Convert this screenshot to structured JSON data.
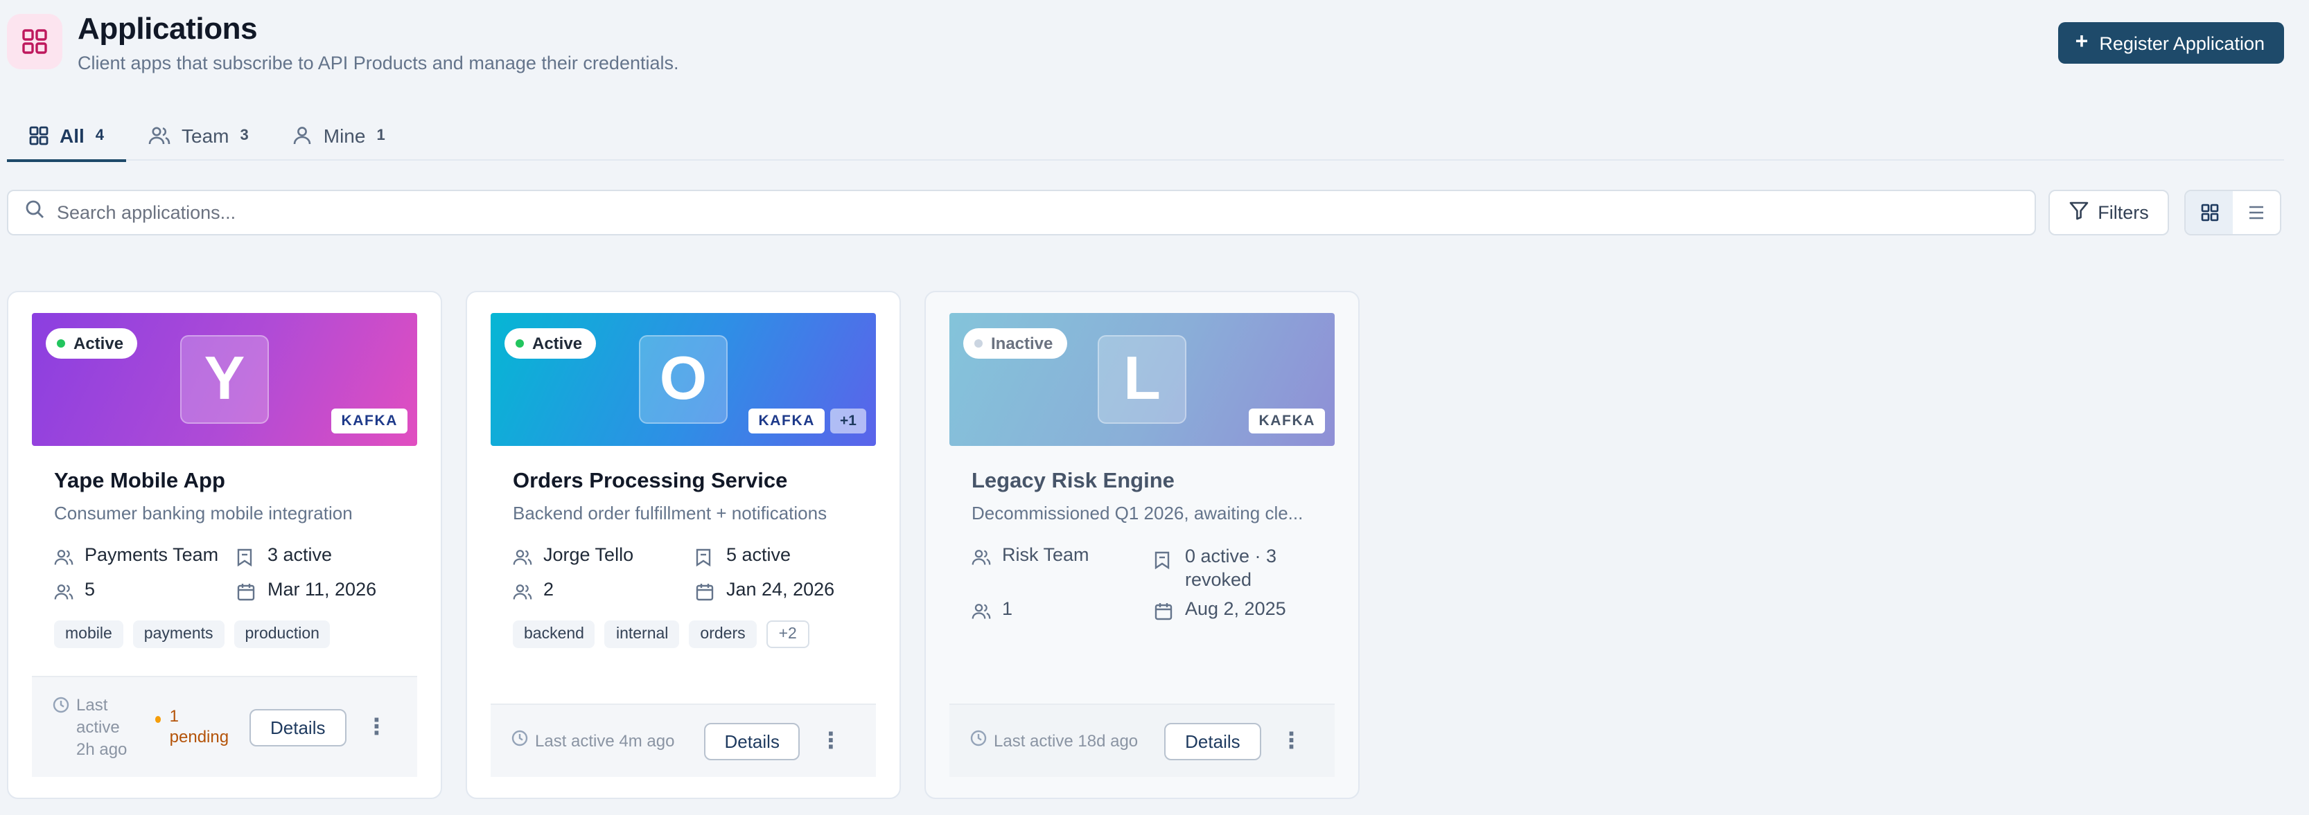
{
  "header": {
    "title": "Applications",
    "subtitle": "Client apps that subscribe to API Products and manage their credentials.",
    "register_label": "Register Application"
  },
  "tabs": [
    {
      "label": "All",
      "count": "4",
      "icon": "grid-icon",
      "active": true
    },
    {
      "label": "Team",
      "count": "3",
      "icon": "users-icon",
      "active": false
    },
    {
      "label": "Mine",
      "count": "1",
      "icon": "user-icon",
      "active": false
    }
  ],
  "search": {
    "placeholder": "Search applications..."
  },
  "filters_label": "Filters",
  "view": {
    "selected": "grid"
  },
  "cards": [
    {
      "status": "Active",
      "initial": "Y",
      "protocol": "KAFKA",
      "name": "Yape Mobile App",
      "description": "Consumer banking mobile integration",
      "team": "Payments Team",
      "credentials": "3 active",
      "members": "5",
      "date": "Mar 11, 2026",
      "tags": [
        "mobile",
        "payments",
        "production"
      ],
      "last_active": "Last active 2h ago",
      "pending": "1 pending",
      "details_label": "Details",
      "gradient": [
        "#8b3fe0",
        "#e14ec0"
      ]
    },
    {
      "status": "Active",
      "initial": "O",
      "protocol": "KAFKA",
      "protocol_more": "+1",
      "name": "Orders Processing Service",
      "description": "Backend order fulfillment + notifications",
      "team": "Jorge Tello",
      "credentials": "5 active",
      "members": "2",
      "date": "Jan 24, 2026",
      "tags": [
        "backend",
        "internal",
        "orders"
      ],
      "tags_more": "+2",
      "last_active": "Last active 4m ago",
      "details_label": "Details",
      "gradient": [
        "#06b6d4",
        "#5b63ea"
      ]
    },
    {
      "status": "Inactive",
      "initial": "L",
      "protocol": "KAFKA",
      "name": "Legacy Risk Engine",
      "description": "Decommissioned Q1 2026, awaiting cle...",
      "team": "Risk Team",
      "credentials_line1": "0 active · 3",
      "credentials_line2": "revoked",
      "members": "1",
      "date": "Aug 2, 2025",
      "last_active": "Last active 18d ago",
      "details_label": "Details",
      "gradient": [
        "#84c4da",
        "#8f8fd6"
      ]
    }
  ],
  "colors": {
    "primary": "#1e4a6a",
    "active_dot": "#22c55e",
    "pending": "#b45309",
    "app_icon_bg": "#fce4ef",
    "app_icon_fg": "#be185d"
  }
}
